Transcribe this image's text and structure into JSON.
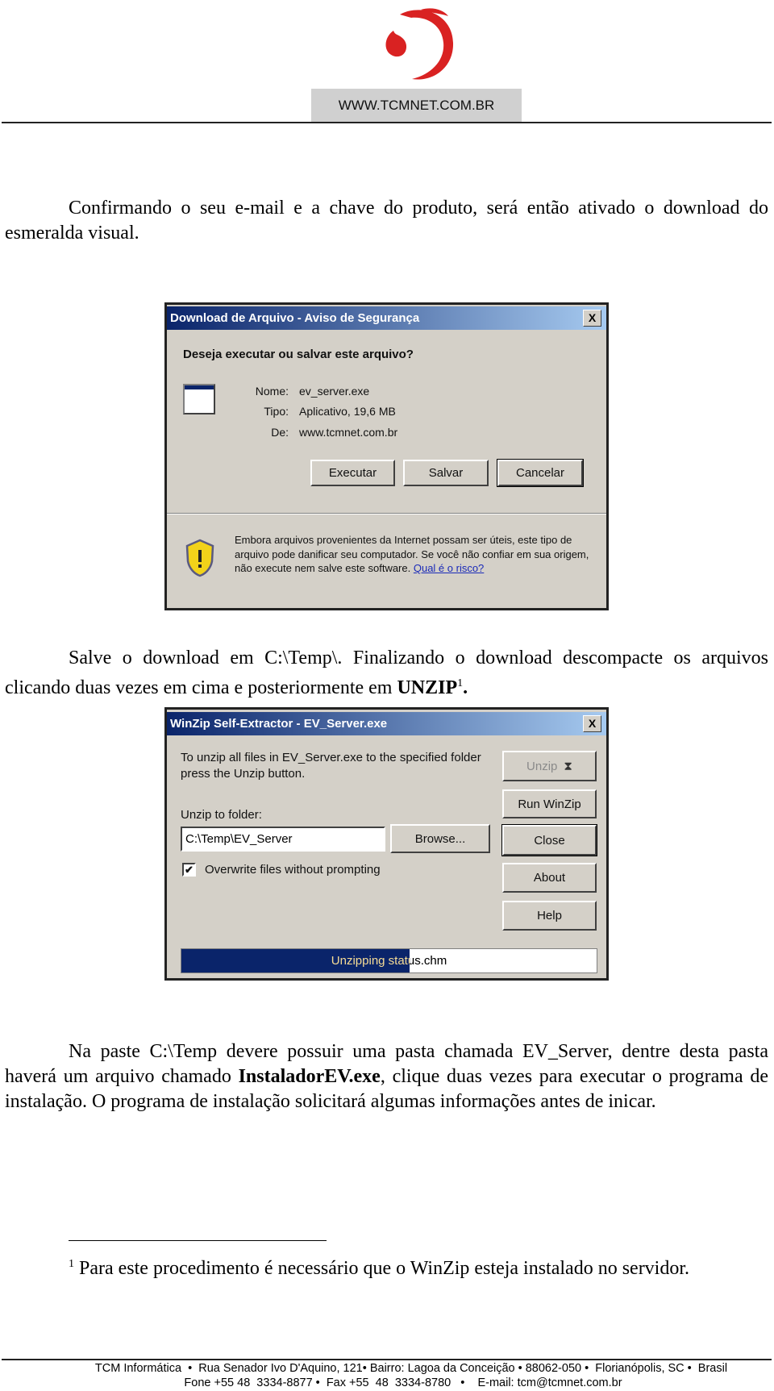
{
  "header": {
    "logo_alt": "TCM swirl logo",
    "logo_color": "#d92222",
    "website": "WWW.TCMNET.COM.BR"
  },
  "paragraphs": {
    "p1": "Confirmando o seu e-mail e a chave do produto, será então ativado o download do esmeralda visual.",
    "p2_text": "Salve o download em C:\\Temp\\. Finalizando o download descompacte os arquivos clicando duas vezes em cima e posteriormente em ",
    "p2_bold": "UNZIP",
    "p2_sup": "1",
    "p2_end": ".",
    "p3_a": "Na paste C:\\Temp devere possuir uma pasta chamada EV_Server, dentre desta pasta haverá um arquivo chamado ",
    "p3_bold": "InstaladorEV.exe",
    "p3_b": ", clique duas vezes para executar o programa de instalação. O programa de instalação solicitará algumas informações antes de inicar."
  },
  "dialog1": {
    "title": "Download de Arquivo - Aviso de Segurança",
    "close": "X",
    "question": "Deseja executar ou salvar este arquivo?",
    "fields": [
      {
        "label": "Nome:",
        "value": "ev_server.exe"
      },
      {
        "label": "Tipo:",
        "value": "Aplicativo, 19,6 MB"
      },
      {
        "label": "De:",
        "value": "www.tcmnet.com.br"
      }
    ],
    "buttons": {
      "run": "Executar",
      "save": "Salvar",
      "cancel": "Cancelar"
    },
    "warning": "Embora arquivos provenientes da Internet possam ser úteis, este tipo de arquivo pode danificar seu computador. Se você não confiar em sua origem, não execute nem salve este software. ",
    "warning_link": "Qual é o risco?"
  },
  "dialog2": {
    "title": "WinZip Self-Extractor - EV_Server.exe",
    "close": "X",
    "instructions": "To unzip all files in EV_Server.exe to the specified folder press the Unzip button.",
    "folder_label": "Unzip to folder:",
    "folder_value": "C:\\Temp\\EV_Server",
    "browse": "Browse...",
    "overwrite_label": "Overwrite files without prompting",
    "overwrite_checked": true,
    "buttons": {
      "unzip": "Unzip",
      "run_winzip": "Run WinZip",
      "close": "Close",
      "about": "About",
      "help": "Help"
    },
    "status": "Unzipping status.chm",
    "progress_percent": 55
  },
  "footnote": {
    "number": "1",
    "text": "Para este procedimento é necessário que o WinZip esteja instalado no servidor."
  },
  "footer": {
    "line1": "TCM Informática  •  Rua Senador Ivo D'Aquino, 121• Bairro: Lagoa da Conceição • 88062-050 •  Florianópolis, SC •  Brasil",
    "line2": "Fone +55 48  3334-8877 •  Fax +55  48  3334-8780   •    E-mail: tcm@tcmnet.com.br"
  }
}
